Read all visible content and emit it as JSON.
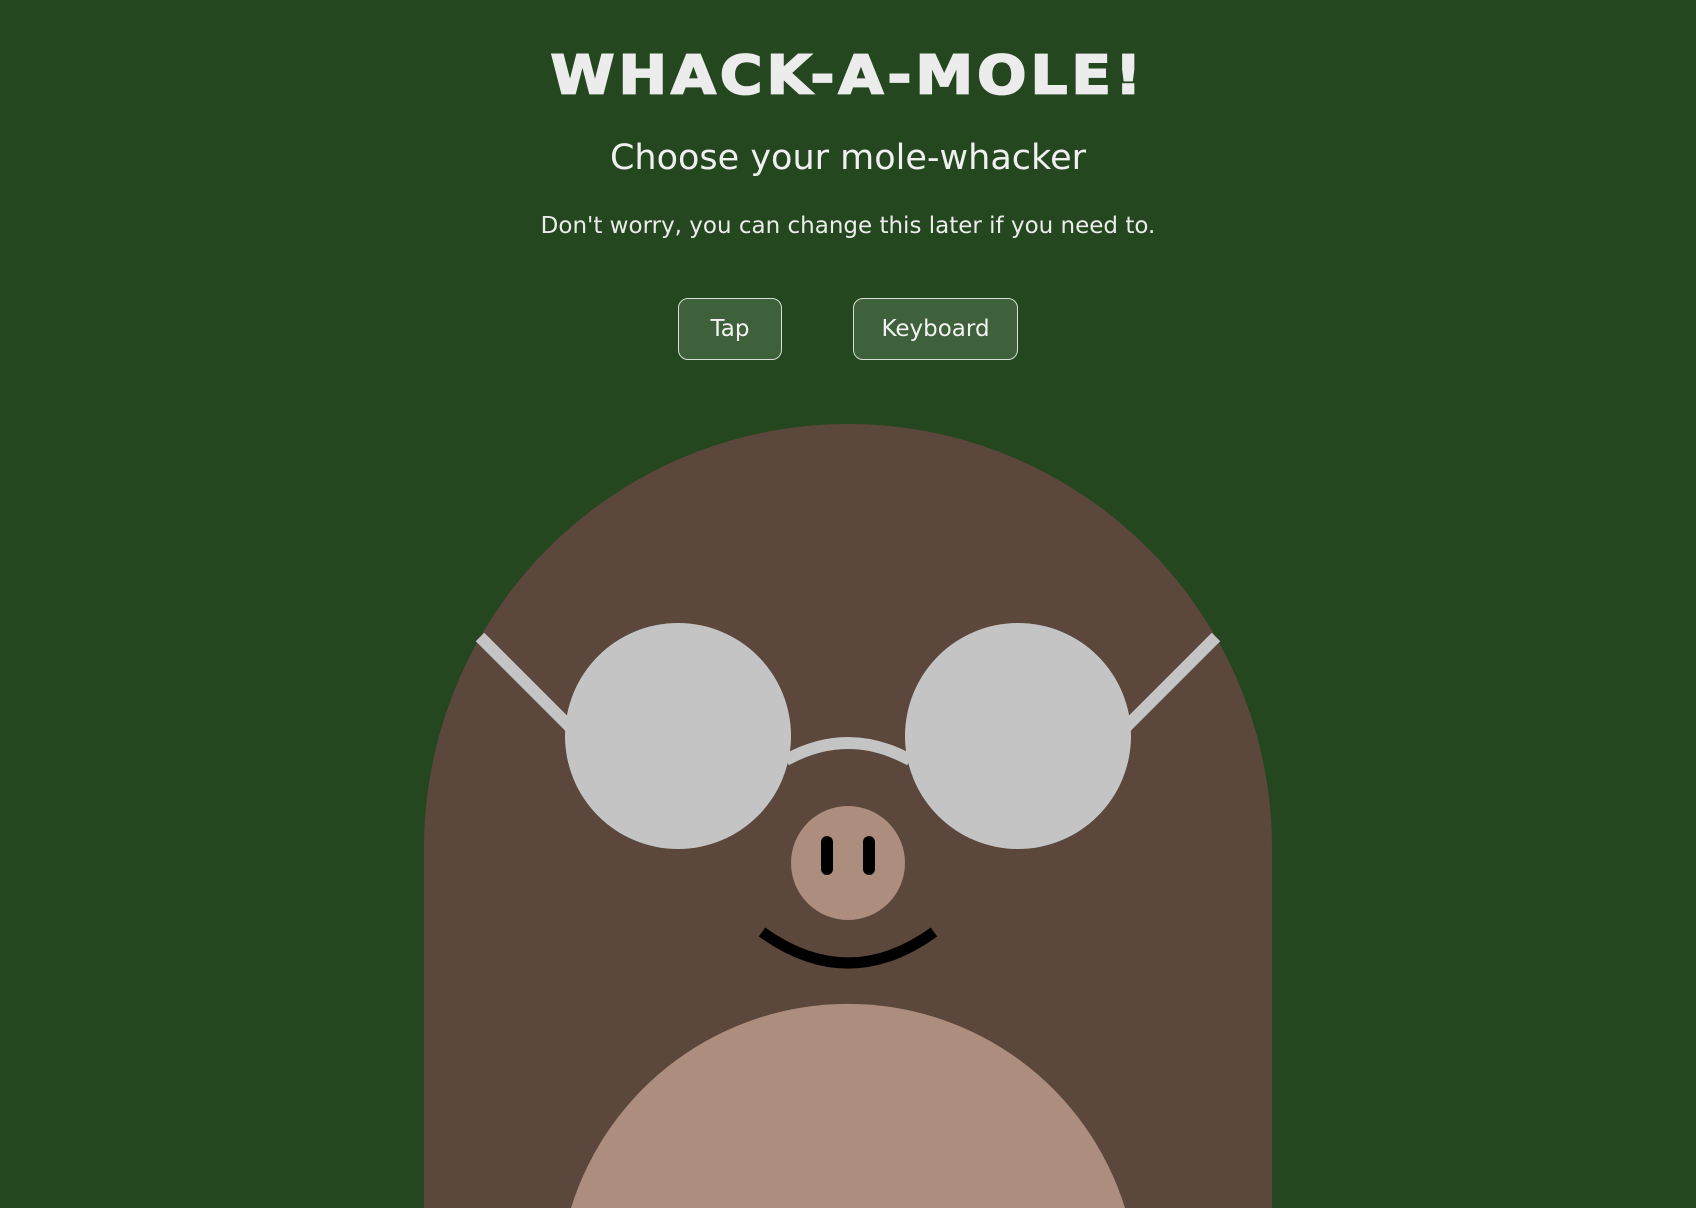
{
  "app": {
    "title": "WHACK-A-MOLE!",
    "subtitle": "Choose your mole-whacker",
    "hint": "Don't worry, you can change this later if you need to."
  },
  "controls": {
    "tap_label": "Tap",
    "keyboard_label": "Keyboard"
  },
  "mole": {
    "body_color": "#5c473d",
    "belly_color": "#ad8d7d",
    "glasses_color": "#c4c4c4",
    "nose_color": "#ad8d7d",
    "feature_color": "#000000"
  },
  "theme": {
    "background": "#24471f",
    "button_background": "#3e603a"
  }
}
